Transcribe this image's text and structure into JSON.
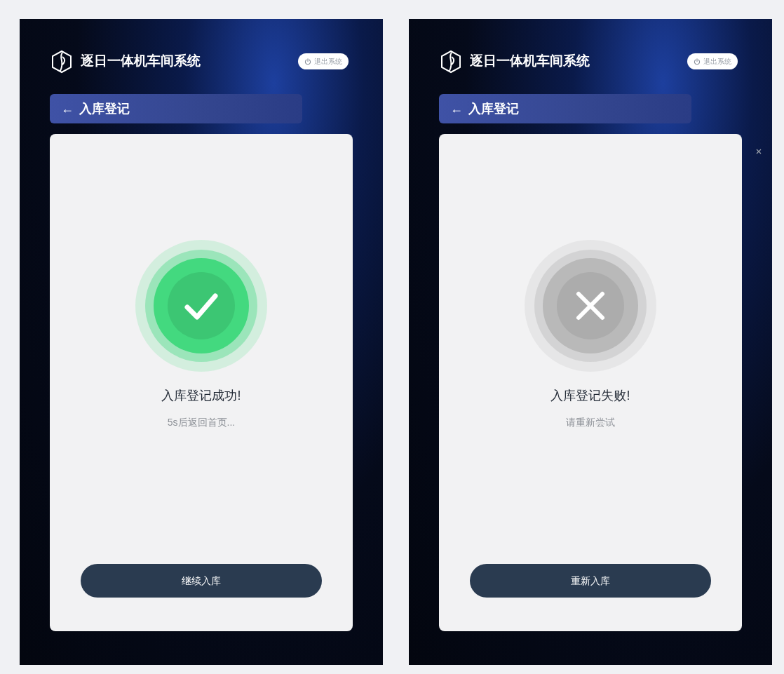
{
  "screens": [
    {
      "app_title": "逐日一体机车间系统",
      "logout": "退出系统",
      "back_arrow": "←",
      "page_title": "入库登记",
      "result": {
        "kind": "success",
        "title": "入库登记成功!",
        "message": "5s后返回首页..."
      },
      "action": "继续入库"
    },
    {
      "app_title": "逐日一体机车间系统",
      "logout": "退出系统",
      "back_arrow": "←",
      "page_title": "入库登记",
      "result": {
        "kind": "failure",
        "title": "入库登记失败!",
        "message": "请重新尝试"
      },
      "action": "重新入库",
      "dismissible": true
    }
  ]
}
